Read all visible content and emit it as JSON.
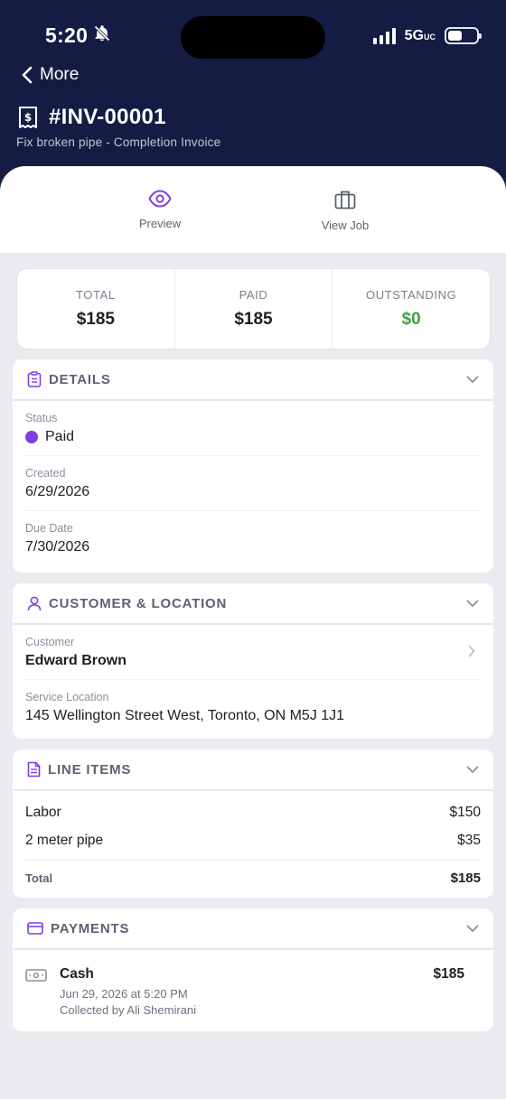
{
  "status_bar": {
    "time": "5:20",
    "network": "5G",
    "network_sub": "UC"
  },
  "nav": {
    "back_label": "More"
  },
  "invoice": {
    "number": "#INV-00001",
    "subtitle": "Fix broken pipe - Completion Invoice"
  },
  "actions": [
    {
      "label": "Preview",
      "icon": "eye-icon"
    },
    {
      "label": "View Job",
      "icon": "briefcase-icon"
    }
  ],
  "summary": {
    "total_label": "TOTAL",
    "total_value": "$185",
    "paid_label": "PAID",
    "paid_value": "$185",
    "outstanding_label": "OUTSTANDING",
    "outstanding_value": "$0"
  },
  "details": {
    "title": "DETAILS",
    "status_label": "Status",
    "status_value": "Paid",
    "created_label": "Created",
    "created_value": "6/29/2026",
    "due_label": "Due Date",
    "due_value": "7/30/2026"
  },
  "customer": {
    "title": "CUSTOMER & LOCATION",
    "customer_label": "Customer",
    "customer_value": "Edward Brown",
    "location_label": "Service Location",
    "location_value": "145 Wellington Street West, Toronto, ON M5J 1J1"
  },
  "line_items": {
    "title": "LINE ITEMS",
    "items": [
      {
        "name": "Labor",
        "amount": "$150"
      },
      {
        "name": "2 meter pipe",
        "amount": "$35"
      }
    ],
    "total_label": "Total",
    "total_value": "$185"
  },
  "payments": {
    "title": "PAYMENTS",
    "method": "Cash",
    "amount": "$185",
    "date": "Jun 29, 2026 at 5:20 PM",
    "collected_by": "Collected by Ali Shemirani"
  },
  "colors": {
    "header": "#141c44",
    "accent": "#7c3fe0",
    "positive": "#43a047"
  }
}
